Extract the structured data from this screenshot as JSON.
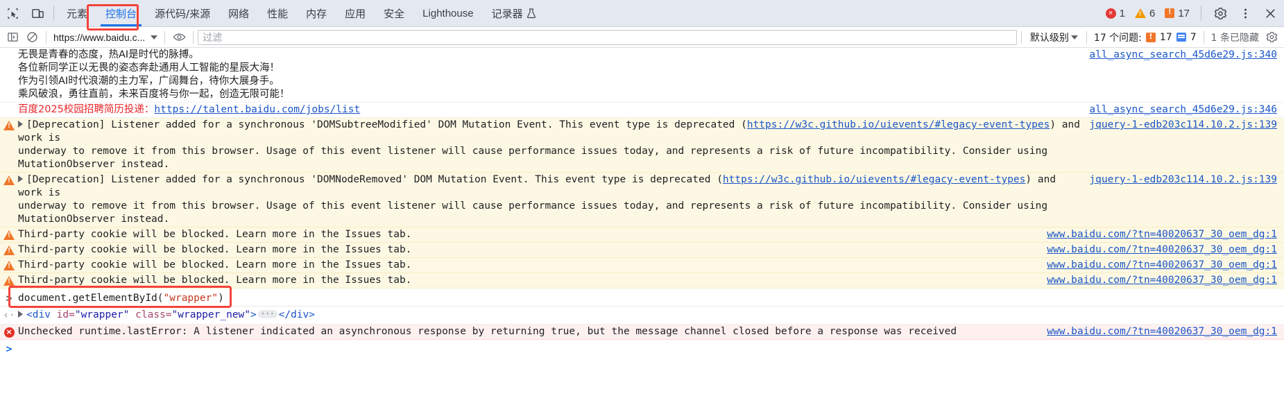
{
  "tabbar": {
    "icons": [
      {
        "name": "inspect-element-icon",
        "label": "Inspect"
      },
      {
        "name": "device-toolbar-icon",
        "label": "Toggle device toolbar"
      }
    ],
    "tabs": [
      {
        "label": "元素",
        "name": "tab-elements",
        "active": false
      },
      {
        "label": "控制台",
        "name": "tab-console",
        "active": true
      },
      {
        "label": "源代码/来源",
        "name": "tab-sources",
        "active": false
      },
      {
        "label": "网络",
        "name": "tab-network",
        "active": false
      },
      {
        "label": "性能",
        "name": "tab-performance",
        "active": false
      },
      {
        "label": "内存",
        "name": "tab-memory",
        "active": false
      },
      {
        "label": "应用",
        "name": "tab-application",
        "active": false
      },
      {
        "label": "安全",
        "name": "tab-security",
        "active": false
      },
      {
        "label": "Lighthouse",
        "name": "tab-lighthouse",
        "active": false
      },
      {
        "label": "记录器",
        "name": "tab-recorder",
        "active": false
      }
    ],
    "counters": {
      "errors": "1",
      "warnings": "6",
      "info": "17"
    },
    "settings_icon": "gear-icon",
    "more_icon": "more-vertical-icon",
    "close_icon": "close-icon"
  },
  "filterbar": {
    "sidebar_icon": "console-sidebar-icon",
    "clear_icon": "clear-console-icon",
    "context": "https://www.baidu.c...",
    "eye_icon": "live-expression-eye-icon",
    "filter_placeholder": "过滤",
    "filter_value": "",
    "level": "默认级别",
    "issues_label": "17 个问题:",
    "issues_count": "17",
    "messages_count": "7",
    "hidden_label": "1 条已隐藏",
    "settings_icon": "console-settings-gear-icon"
  },
  "console": {
    "rows": [
      {
        "type": "log",
        "lines": [
          "无畏是青春的态度，热AI是时代的脉搏。",
          "各位新同学正以无畏的姿态奔赴通用人工智能的星辰大海！",
          "作为引领AI时代浪潮的主力军，广阔舞台，待你大展身手。",
          "乘风破浪，勇往直前，未来百度将与你一起，创造无限可能！"
        ],
        "source": "all_async_search_45d6e29.js:340"
      },
      {
        "type": "log-link",
        "prefix": "百度2025校园招聘简历投递：",
        "link": "https://talent.baidu.com/jobs/list",
        "source": "all_async_search_45d6e29.js:346"
      },
      {
        "type": "warning-deprecation",
        "seg1": "[Deprecation] Listener added for a synchronous 'DOMSubtreeModified' DOM Mutation Event. This event type is deprecated (",
        "link": "https://w3c.github.io/uievents/#legacy-event-types",
        "seg2": ") and work is",
        "line2": "underway to remove it from this browser. Usage of this event listener will cause performance issues today, and represents a risk of future incompatibility. Consider using MutationObserver instead.",
        "source": "jquery-1-edb203c114.10.2.js:139"
      },
      {
        "type": "warning-deprecation",
        "seg1": "[Deprecation] Listener added for a synchronous 'DOMNodeRemoved' DOM Mutation Event. This event type is deprecated (",
        "link": "https://w3c.github.io/uievents/#legacy-event-types",
        "seg2": ") and work is",
        "line2": "underway to remove it from this browser. Usage of this event listener will cause performance issues today, and represents a risk of future incompatibility. Consider using MutationObserver instead.",
        "source": "jquery-1-edb203c114.10.2.js:139"
      },
      {
        "type": "warning",
        "text": "Third-party cookie will be blocked. Learn more in the Issues tab.",
        "source": "www.baidu.com/?tn=40020637_30_oem_dg:1"
      },
      {
        "type": "warning",
        "text": "Third-party cookie will be blocked. Learn more in the Issues tab.",
        "source": "www.baidu.com/?tn=40020637_30_oem_dg:1"
      },
      {
        "type": "warning",
        "text": "Third-party cookie will be blocked. Learn more in the Issues tab.",
        "source": "www.baidu.com/?tn=40020637_30_oem_dg:1"
      },
      {
        "type": "warning",
        "text": "Third-party cookie will be blocked. Learn more in the Issues tab.",
        "source": "www.baidu.com/?tn=40020637_30_oem_dg:1"
      }
    ],
    "command": {
      "prompt": ">",
      "text_plain_1": "document.getElementById(",
      "text_string": "\"wrapper\"",
      "text_plain_2": ")"
    },
    "result": {
      "arrow": "‹·",
      "tag_open": "<div",
      "attr1_name": " id=",
      "attr1_value": "\"wrapper\"",
      "attr2_name": " class=",
      "attr2_value": "\"wrapper_new\"",
      "tag_close_open": ">",
      "ellipsis": "···",
      "tag_close": "</div>"
    },
    "error": {
      "text": "Unchecked runtime.lastError: A listener indicated an asynchronous response by returning true, but the message channel closed before a response was received",
      "source": "www.baidu.com/?tn=40020637_30_oem_dg:1"
    },
    "final_prompt": ">"
  },
  "colors": {
    "accent": "#1a73e8",
    "warning_bg": "#fdf8e3",
    "error_bg": "#fff0f0",
    "link": "#1a56c7",
    "highlight_box": "#f4433b",
    "red_text": "#e8262a"
  }
}
